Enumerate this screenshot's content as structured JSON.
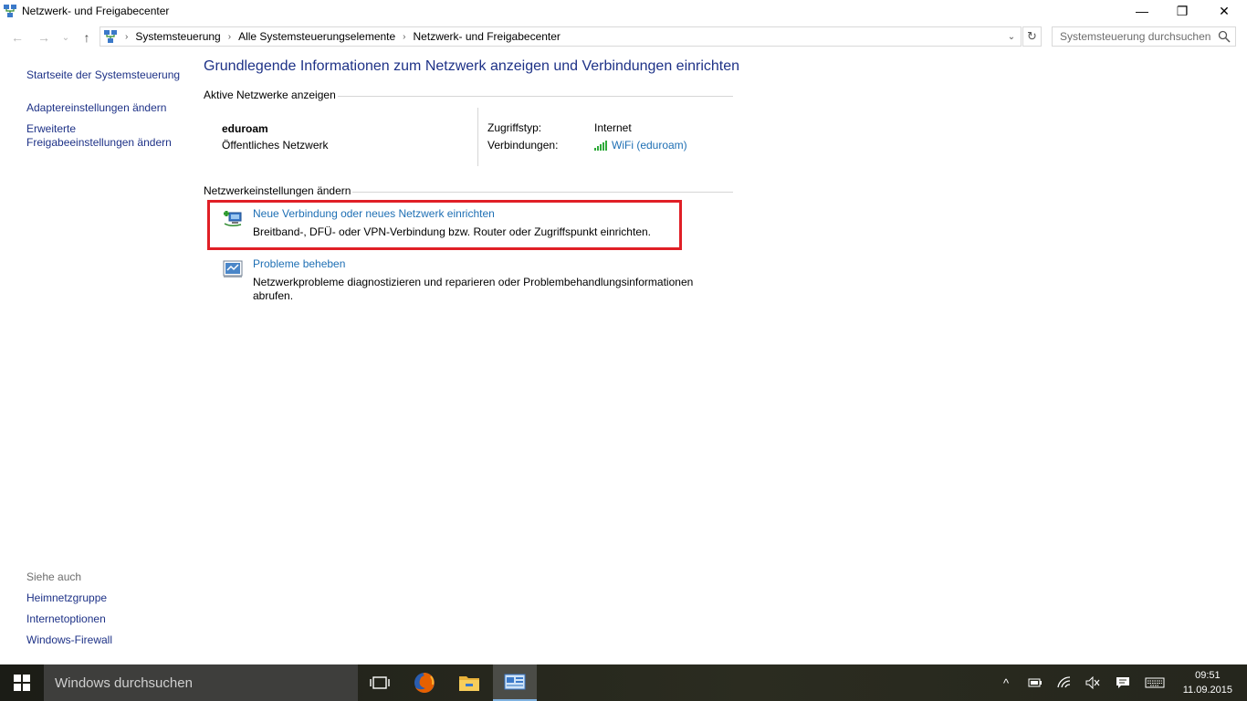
{
  "window": {
    "title": "Netzwerk- und Freigabecenter",
    "minimize": "—",
    "maximize": "❐",
    "close": "✕"
  },
  "nav": {
    "back": "←",
    "forward": "→",
    "recent": "⌄",
    "up": "↑",
    "breadcrumbs": [
      "Systemsteuerung",
      "Alle Systemsteuerungselemente",
      "Netzwerk- und Freigabecenter"
    ],
    "search_placeholder": "Systemsteuerung durchsuchen"
  },
  "sidebar": {
    "items": [
      "Startseite der Systemsteuerung",
      "Adaptereinstellungen ändern",
      "Erweiterte",
      "Freigabeeinstellungen ändern"
    ],
    "see_also_label": "Siehe auch",
    "see_also": [
      "Heimnetzgruppe",
      "Internetoptionen",
      "Windows-Firewall"
    ]
  },
  "main": {
    "title": "Grundlegende Informationen zum Netzwerk anzeigen und Verbindungen einrichten",
    "active_section": "Aktive Netzwerke anzeigen",
    "network": {
      "name": "eduroam",
      "type": "Öffentliches Netzwerk",
      "access_label": "Zugriffstyp:",
      "access_value": "Internet",
      "connections_label": "Verbindungen:",
      "connections_value": "WiFi (eduroam)"
    },
    "settings_section": "Netzwerkeinstellungen ändern",
    "tasks": [
      {
        "title": "Neue Verbindung oder neues Netzwerk einrichten",
        "description": "Breitband-, DFÜ- oder VPN-Verbindung bzw. Router oder Zugriffspunkt einrichten."
      },
      {
        "title": "Probleme beheben",
        "description": "Netzwerkprobleme diagnostizieren und reparieren oder Problembehandlungsinformationen abrufen."
      }
    ]
  },
  "taskbar": {
    "search_placeholder": "Windows durchsuchen",
    "clock_time": "09:51",
    "clock_date": "11.09.2015"
  },
  "colors": {
    "link": "#1e3287",
    "task_link": "#1e6fb4",
    "highlight": "#e01f26"
  }
}
